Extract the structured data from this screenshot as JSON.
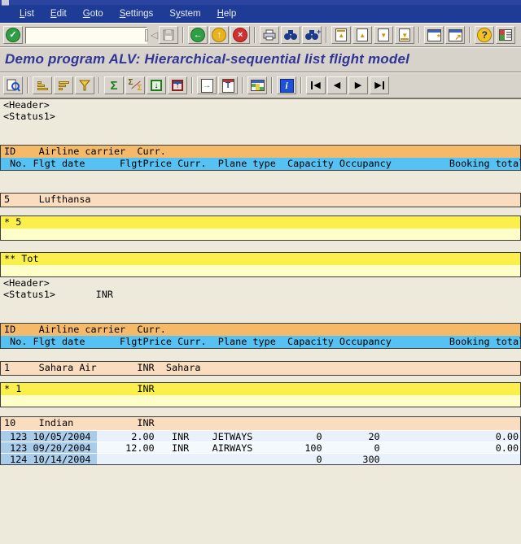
{
  "window": {
    "menu": {
      "items": [
        {
          "label": "List",
          "mnemonic": 0
        },
        {
          "label": "Edit",
          "mnemonic": 0
        },
        {
          "label": "Goto",
          "mnemonic": 0
        },
        {
          "label": "Settings",
          "mnemonic": 0
        },
        {
          "label": "System",
          "mnemonic": 1
        },
        {
          "label": "Help",
          "mnemonic": 0
        }
      ]
    },
    "command_value": ""
  },
  "title": "Demo program ALV: Hierarchical-sequential list flight model",
  "icons": {
    "enter": "✓",
    "back_nav": "◁",
    "back": "←",
    "exit": "↑",
    "cancel": "×",
    "page_up": "▲",
    "page_down": "▼",
    "session_star": "*",
    "shortcut_arrow": "↗",
    "help": "?",
    "sum": "Σ",
    "subtotal_sigma": "Σ",
    "download_arrow": "↓",
    "upload_arrow": "↑",
    "export_arrow": "→",
    "word_letter": "T",
    "info_letter": "i",
    "nav_prev": "◀",
    "nav_next": "▶"
  },
  "list": {
    "labels": {
      "header": "<Header>",
      "status": "<Status1>",
      "status2_value": "INR"
    },
    "table_header": {
      "row1": "ID    Airline carrier  Curr.",
      "row2": " No. Flgt date      FlgtPrice Curr.  Plane type  Capacity Occupancy          Booking total"
    },
    "table1": {
      "airline_row": "5     Lufthansa",
      "subtotal_row": "* 5",
      "grandtotal_row": "** Tot"
    },
    "table2": {
      "airline1_row": "1     Sahara Air       INR  Sahara",
      "subtotal1_row": "* 1                    INR",
      "airline2_row": "10    Indian           INR",
      "detail_rows": [
        " 123 10/05/2004       2.00   INR    JETWAYS           0        20                    0.00",
        " 123 09/20/2004      12.00   INR    AIRWAYS         100         0                    0.00",
        " 124 10/14/2004                                       0       300"
      ]
    }
  }
}
